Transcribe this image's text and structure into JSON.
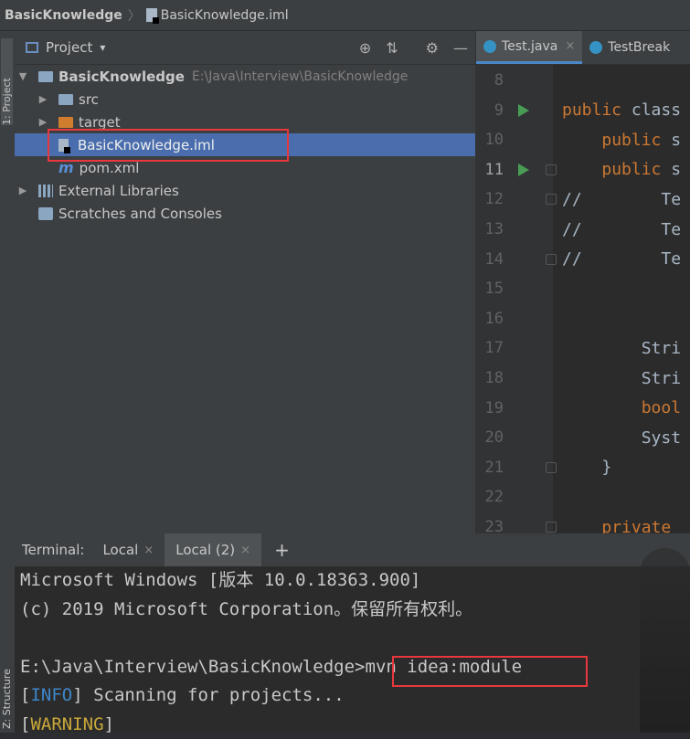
{
  "breadcrumb": {
    "project": "BasicKnowledge",
    "separator": "〉",
    "file": "BasicKnowledge.iml"
  },
  "left_strip": {
    "project_label": "1: Project",
    "structure_label": "Z: Structure"
  },
  "project_panel": {
    "title": "Project",
    "dropdown": "▾",
    "tools": [
      "⊕",
      "⇅",
      "⚙",
      "—"
    ],
    "tree": [
      {
        "label": "BasicKnowledge",
        "path": "E:\\Java\\Interview\\BasicKnowledge",
        "arrow": "▼",
        "icon": "module-folder-icon"
      },
      {
        "label": "src",
        "arrow": "▶",
        "icon": "folder-icon"
      },
      {
        "label": "target",
        "arrow": "▶",
        "icon": "excluded-folder-icon"
      },
      {
        "label": "BasicKnowledge.iml",
        "arrow": "",
        "icon": "iml-file-icon"
      },
      {
        "label": "pom.xml",
        "arrow": "",
        "icon": "maven-icon"
      },
      {
        "label": "External Libraries",
        "arrow": "▶",
        "icon": "library-icon"
      },
      {
        "label": "Scratches and Consoles",
        "arrow": "",
        "icon": "scratches-icon"
      }
    ]
  },
  "editor": {
    "tabs": [
      {
        "label": "Test.java",
        "close": "×"
      },
      {
        "label": "TestBreak"
      }
    ],
    "lines": [
      {
        "no": "8",
        "code": ""
      },
      {
        "no": "9",
        "code": "public class",
        "run": true
      },
      {
        "no": "10",
        "code": "    public s"
      },
      {
        "no": "11",
        "code": "    public s",
        "run": true,
        "fold": true
      },
      {
        "no": "12",
        "code": "//        Te",
        "fold": true
      },
      {
        "no": "13",
        "code": "//        Te"
      },
      {
        "no": "14",
        "code": "//        Te",
        "fold": true
      },
      {
        "no": "15",
        "code": ""
      },
      {
        "no": "16",
        "code": ""
      },
      {
        "no": "17",
        "code": "        Stri"
      },
      {
        "no": "18",
        "code": "        Stri"
      },
      {
        "no": "19",
        "code": "        bool"
      },
      {
        "no": "20",
        "code": "        Syst"
      },
      {
        "no": "21",
        "code": "    }",
        "fold": true
      },
      {
        "no": "22",
        "code": ""
      },
      {
        "no": "23",
        "code": "    private",
        "fold": true
      }
    ]
  },
  "terminal": {
    "label": "Terminal:",
    "tabs": [
      {
        "label": "Local",
        "close": "×"
      },
      {
        "label": "Local (2)",
        "close": "×"
      }
    ],
    "add": "+",
    "lines": [
      {
        "text": "Microsoft Windows [版本 10.0.18363.900]"
      },
      {
        "text": "(c) 2019 Microsoft Corporation。保留所有权利。"
      },
      {
        "text": ""
      },
      {
        "prompt": "E:\\Java\\Interview\\BasicKnowledge>",
        "command": "mvn idea:module"
      },
      {
        "tag": "INFO",
        "text": " Scanning for projects..."
      },
      {
        "tag": "WARNING",
        "text": ""
      }
    ]
  }
}
